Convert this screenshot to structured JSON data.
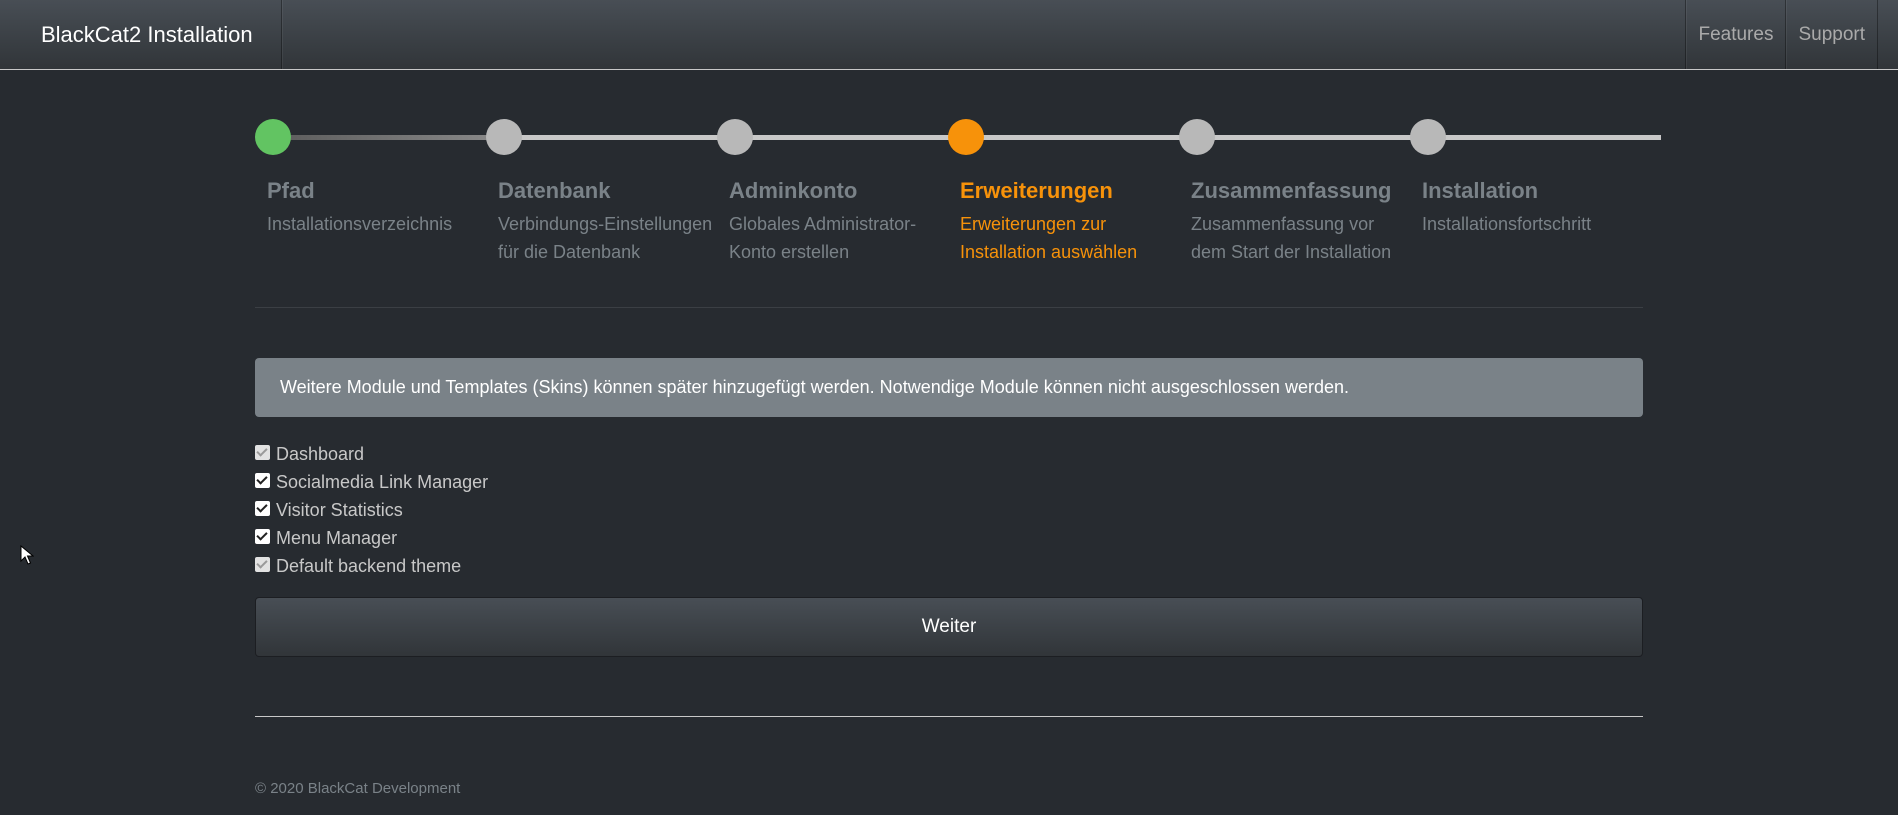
{
  "navbar": {
    "brand": "BlackCat2 Installation",
    "links": [
      "Features",
      "Support"
    ]
  },
  "wizard": {
    "steps": [
      {
        "title": "Pfad",
        "description": "Installationsverzeichnis",
        "state": "done"
      },
      {
        "title": "Datenbank",
        "description": "Verbindungs-Einstellungen für die Datenbank",
        "state": "pending"
      },
      {
        "title": "Adminkonto",
        "description": "Globales Administrator-Konto erstellen",
        "state": "pending"
      },
      {
        "title": "Erweiterungen",
        "description": "Erweiterungen zur Installation auswählen",
        "state": "active"
      },
      {
        "title": "Zusammenfassung",
        "description": "Zusammenfassung vor dem Start der Installation",
        "state": "pending"
      },
      {
        "title": "Installation",
        "description": "Installationsfortschritt",
        "state": "pending"
      }
    ]
  },
  "info": {
    "message": "Weitere Module und Templates (Skins) können später hinzugefügt werden. Notwendige Module können nicht ausgeschlossen werden."
  },
  "modules": [
    {
      "label": "Dashboard",
      "checked": true,
      "required": true
    },
    {
      "label": "Socialmedia Link Manager",
      "checked": true,
      "required": false
    },
    {
      "label": "Visitor Statistics",
      "checked": true,
      "required": false
    },
    {
      "label": "Menu Manager",
      "checked": true,
      "required": false
    },
    {
      "label": "Default backend theme",
      "checked": true,
      "required": true
    }
  ],
  "actions": {
    "next_label": "Weiter"
  },
  "footer": {
    "copyright": "© 2020 BlackCat Development"
  },
  "colors": {
    "background": "#272b30",
    "done": "#62c462",
    "active": "#f7920a",
    "pending": "#b8b8b8",
    "alert": "#7a8288"
  },
  "icons": {
    "cursor": "mouse-pointer-icon",
    "checkbox": "checkmark-icon"
  }
}
